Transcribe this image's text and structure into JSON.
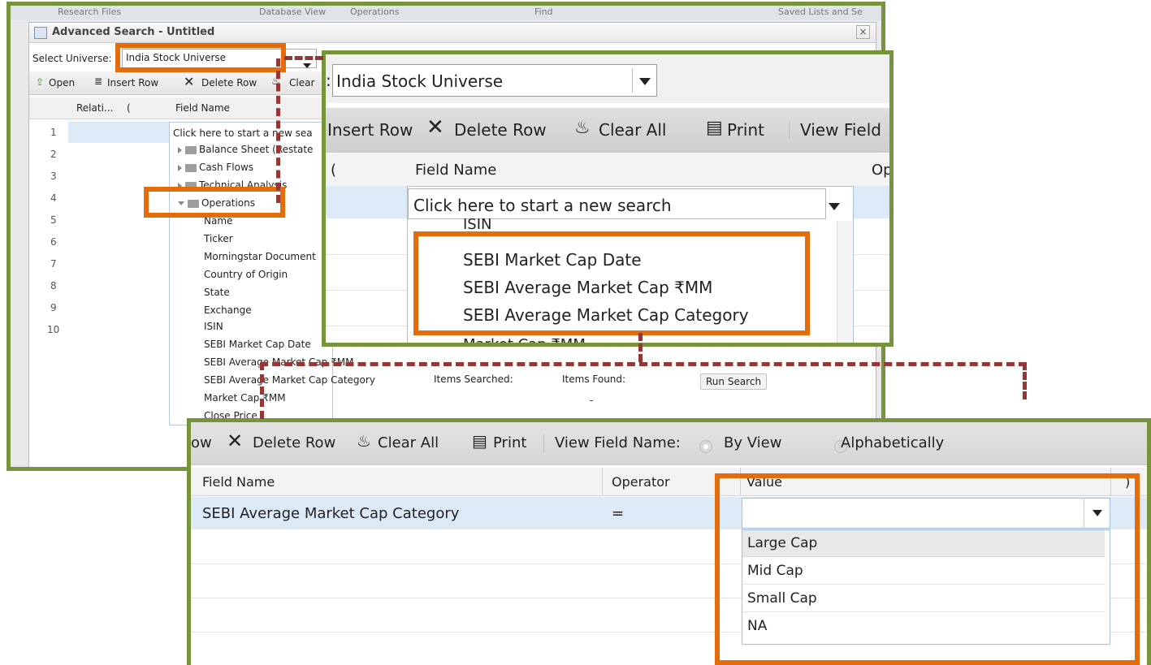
{
  "bg": {
    "tabs": [
      "Research Files",
      "Database View",
      "Operations",
      "Find",
      "Saved Lists and Se"
    ]
  },
  "dialog": {
    "title": "Advanced Search - Untitled",
    "close": "×",
    "universe_label": "Select Universe:",
    "universe_value": "India Stock Universe",
    "toolbar": {
      "open": "Open",
      "insert_row": "Insert Row",
      "delete_row": "Delete Row",
      "clear": "Clear"
    },
    "columns": {
      "relation": "Relati...",
      "paren": "(",
      "field_name": "Field Name"
    },
    "row_numbers": [
      "1",
      "2",
      "3",
      "4",
      "5",
      "6",
      "7",
      "8",
      "9",
      "10"
    ],
    "field_input": "Click here to start a new sea",
    "tree": {
      "folders": [
        "Balance Sheet (Restate",
        "Cash Flows",
        "Technical Analysis",
        "Operations"
      ],
      "items": [
        "Name",
        "Ticker",
        "Morningstar Document",
        "Country of Origin",
        "State",
        "Exchange",
        "ISIN",
        "SEBI Market Cap Date",
        "SEBI Average Market Cap ₹MM",
        "SEBI Average Market Cap Category",
        "Market Cap ₹MM",
        "Close Price"
      ]
    },
    "status": {
      "searched": "Items Searched:",
      "found": "Items Found:",
      "found_value": "-",
      "run": "Run Search"
    }
  },
  "zoom1": {
    "universe_value": "India Stock Universe",
    "toolbar": {
      "insert_row": "Insert Row",
      "delete_row": "Delete Row",
      "clear_all": "Clear All",
      "print": "Print",
      "view_field": "View Field"
    },
    "columns": {
      "paren": "(",
      "field_name": "Field Name",
      "op": "Op"
    },
    "input": "Click here to start a new search",
    "list": [
      "ISIN",
      "SEBI Market Cap Date",
      "SEBI Average Market Cap ₹MM",
      "SEBI Average Market Cap Category",
      "Market Cap ₹MM"
    ]
  },
  "zoom2": {
    "toolbar": {
      "row_fragment": "ow",
      "delete_row": "Delete Row",
      "clear_all": "Clear All",
      "print": "Print",
      "view_field_name": "View Field Name:",
      "by_view": "By View",
      "alphabetically": "Alphabetically"
    },
    "columns": {
      "field_name": "Field Name",
      "operator": "Operator",
      "value": "Value",
      "close_paren": ")"
    },
    "row": {
      "field": "SEBI Average Market Cap Category",
      "operator": "="
    },
    "options": [
      "Large Cap",
      "Mid Cap",
      "Small Cap",
      "NA"
    ]
  },
  "colors": {
    "frame_green": "#77933c",
    "highlight_orange": "#e46c0a",
    "connector_red": "#953735",
    "selection_blue": "#dce9f7"
  }
}
